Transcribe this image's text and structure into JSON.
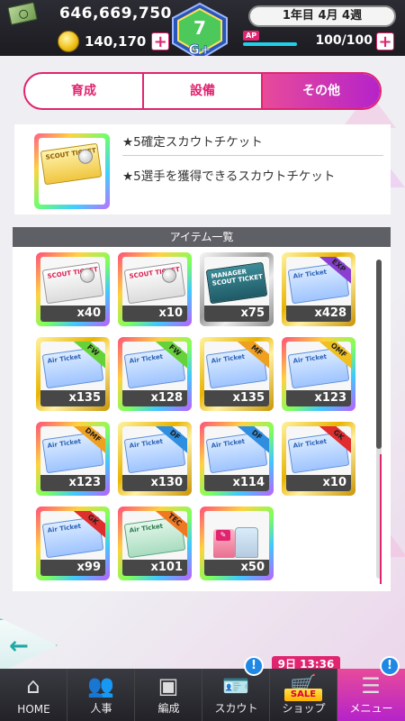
{
  "header": {
    "money": "646,669,750",
    "coins": "140,170",
    "date_label": "1年目 4月 4週",
    "ap_label": "AP",
    "ap_value": "100/100",
    "plus_label": "+",
    "rank": "G+"
  },
  "tabs": [
    {
      "label": "育成",
      "active": false
    },
    {
      "label": "設備",
      "active": false
    },
    {
      "label": "その他",
      "active": true
    }
  ],
  "selected_item": {
    "title": "★5確定スカウトチケット",
    "description": "★5選手を獲得できるスカウトチケット",
    "ticket_text": "SCOUT TICKET"
  },
  "item_list": {
    "header": "アイテム一覧",
    "items": [
      {
        "kind": "scout",
        "frame": "rainbow",
        "qty": "x40",
        "tag": "",
        "ticket_text": "SCOUT TICKET"
      },
      {
        "kind": "scout",
        "frame": "rainbow",
        "qty": "x10",
        "tag": "",
        "ticket_text": "SCOUT TICKET"
      },
      {
        "kind": "manager",
        "frame": "silver",
        "qty": "x75",
        "tag": "",
        "ticket_text": "MANAGER SCOUT TICKET"
      },
      {
        "kind": "air",
        "frame": "gold",
        "qty": "x428",
        "tag": "EXP",
        "tag_color": "#8a3fd1",
        "ticket_text": "Air Ticket"
      },
      {
        "kind": "air",
        "frame": "gold",
        "qty": "x135",
        "tag": "FW",
        "tag_color": "#66d23a",
        "ticket_text": "Air Ticket"
      },
      {
        "kind": "air",
        "frame": "rainbow",
        "qty": "x128",
        "tag": "FW",
        "tag_color": "#66d23a",
        "ticket_text": "Air Ticket"
      },
      {
        "kind": "air",
        "frame": "gold",
        "qty": "x135",
        "tag": "MF",
        "tag_color": "#f0a020",
        "ticket_text": "Air Ticket"
      },
      {
        "kind": "air",
        "frame": "rainbow",
        "qty": "x123",
        "tag": "OMF",
        "tag_color": "#f0c020",
        "ticket_text": "Air Ticket"
      },
      {
        "kind": "air",
        "frame": "rainbow",
        "qty": "x123",
        "tag": "DMF",
        "tag_color": "#f0a020",
        "ticket_text": "Air Ticket"
      },
      {
        "kind": "air",
        "frame": "gold",
        "qty": "x130",
        "tag": "DF",
        "tag_color": "#2f8ee0",
        "ticket_text": "Air Ticket"
      },
      {
        "kind": "air",
        "frame": "rainbow",
        "qty": "x114",
        "tag": "DF",
        "tag_color": "#2f8ee0",
        "ticket_text": "Air Ticket"
      },
      {
        "kind": "air",
        "frame": "gold",
        "qty": "x10",
        "tag": "GK",
        "tag_color": "#e02d2d",
        "ticket_text": "Air Ticket"
      },
      {
        "kind": "air",
        "frame": "rainbow",
        "qty": "x99",
        "tag": "GK",
        "tag_color": "#e02d2d",
        "ticket_text": "Air Ticket"
      },
      {
        "kind": "air-green",
        "frame": "rainbow",
        "qty": "x101",
        "tag": "TEC",
        "tag_color": "#f07820",
        "ticket_text": "Air Ticket"
      },
      {
        "kind": "costume",
        "frame": "rainbow",
        "qty": "x50",
        "tag": "",
        "ticket_text": ""
      }
    ]
  },
  "nav": {
    "items": [
      {
        "label": "HOME",
        "icon": "home-icon",
        "glyph": "⌂",
        "badge": "",
        "active": false
      },
      {
        "label": "人事",
        "icon": "people-icon",
        "glyph": "👥",
        "badge": "",
        "active": false
      },
      {
        "label": "編成",
        "icon": "pitch-icon",
        "glyph": "▣",
        "badge": "",
        "active": false
      },
      {
        "label": "スカウト",
        "icon": "scout-card-icon",
        "glyph": "🪪",
        "badge": "!",
        "active": false
      },
      {
        "label": "ショップ",
        "icon": "cart-icon",
        "glyph": "🛒",
        "badge": "",
        "active": false,
        "sale": "SALE"
      },
      {
        "label": "メニュー",
        "icon": "menu-icon",
        "glyph": "☰",
        "badge": "!",
        "active": true
      }
    ],
    "sale_timer": "9日 13:36"
  },
  "back_button": {
    "glyph": "←"
  },
  "colors": {
    "accent": "#e0246f",
    "accent_purple": "#b523c9",
    "teal": "#1fa8a4"
  }
}
